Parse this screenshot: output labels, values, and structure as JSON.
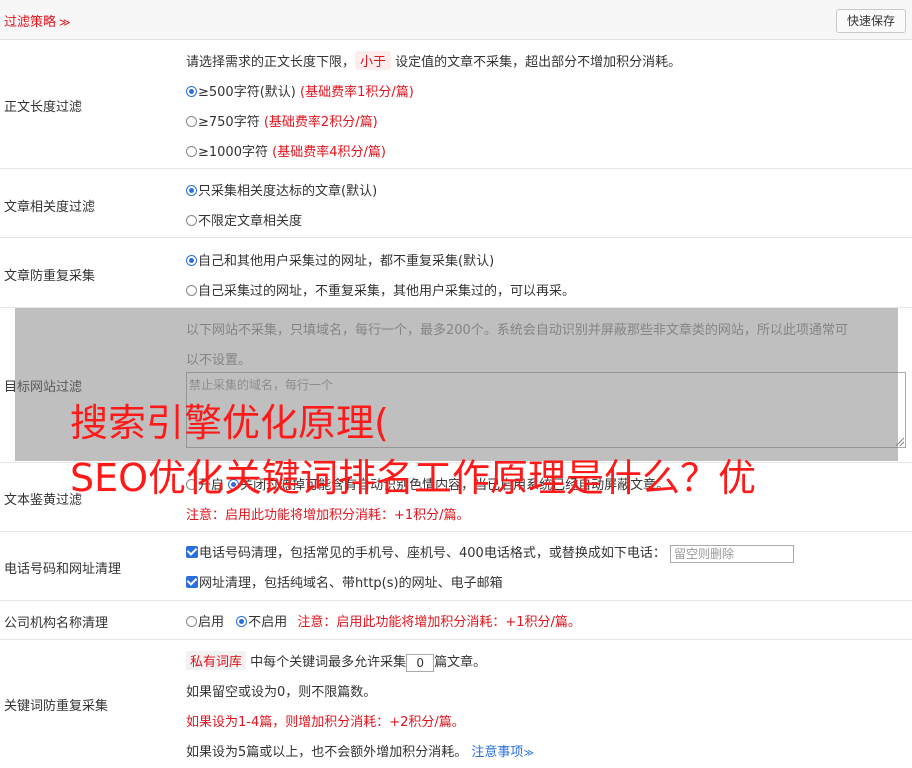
{
  "header": {
    "title": "过滤策略",
    "chevron": "≫",
    "quick_save": "快速保存"
  },
  "length_filter": {
    "label": "正文长度过滤",
    "desc_before": "请选择需求的正文长度下限，",
    "desc_pill": "小于",
    "desc_after": "设定值的文章不采集，超出部分不增加积分消耗。",
    "options": [
      {
        "text": "≥500字符(默认)",
        "note": "(基础费率1积分/篇)",
        "checked": true
      },
      {
        "text": "≥750字符",
        "note": "(基础费率2积分/篇)",
        "checked": false
      },
      {
        "text": "≥1000字符",
        "note": "(基础费率4积分/篇)",
        "checked": false
      }
    ]
  },
  "relevance_filter": {
    "label": "文章相关度过滤",
    "options": [
      {
        "text": "只采集相关度达标的文章(默认)",
        "checked": true
      },
      {
        "text": "不限定文章相关度",
        "checked": false
      }
    ]
  },
  "dedupe": {
    "label": "文章防重复采集",
    "options": [
      {
        "text": "自己和其他用户采集过的网址，都不重复采集(默认)",
        "checked": true
      },
      {
        "text": "自己采集过的网址，不重复采集，其他用户采集过的，可以再采。",
        "checked": false
      }
    ]
  },
  "site_filter": {
    "label": "目标网站过滤",
    "desc_line1": "以下网站不采集，只填域名，每行一个，最多200个。系统会自动识别并屏蔽那些非文章类的网站，所以此项通常可",
    "desc_line2": "以不设置。",
    "placeholder": "禁止采集的域名，每行一个"
  },
  "porn_filter": {
    "label": "文本鉴黄过滤",
    "line1_a": "开启",
    "line1_b": "关闭",
    "line1_rest": "过滤掉可能含有自动识别色情内容，当已启用系统已经自动屏蔽文章。",
    "note": "注意：启用此功能将增加积分消耗：+1积分/篇。"
  },
  "phone_url": {
    "label": "电话号码和网址清理",
    "phone_text": "电话号码清理，包括常见的手机号、座机号、400电话格式，或替换成如下电话：",
    "phone_placeholder": "留空则删除",
    "url_text": "网址清理，包括纯域名、带http(s)的网址、电子邮箱"
  },
  "company": {
    "label": "公司机构名称清理",
    "on": "启用",
    "off": "不启用",
    "note": "注意：启用此功能将增加积分消耗：+1积分/篇。"
  },
  "keyword_dedupe": {
    "label": "关键词防重复采集",
    "pill": "私有词库",
    "text_before": "中每个关键词最多允许采集",
    "value": "0",
    "text_after": "篇文章。",
    "line2": "如果留空或设为0，则不限篇数。",
    "line3": "如果设为1-4篇，则增加积分消耗：+2积分/篇。",
    "line4": "如果设为5篇或以上，也不会额外增加积分消耗。",
    "notice_link": "注意事项",
    "notice_chev": "≫"
  },
  "watermark": {
    "line1": "搜索引擎优化原理(",
    "line2": "SEO优化关键词排名工作原理是什么？优"
  },
  "colors": {
    "accent_red": "#e0141e",
    "radio_blue": "#2a6fdc"
  }
}
